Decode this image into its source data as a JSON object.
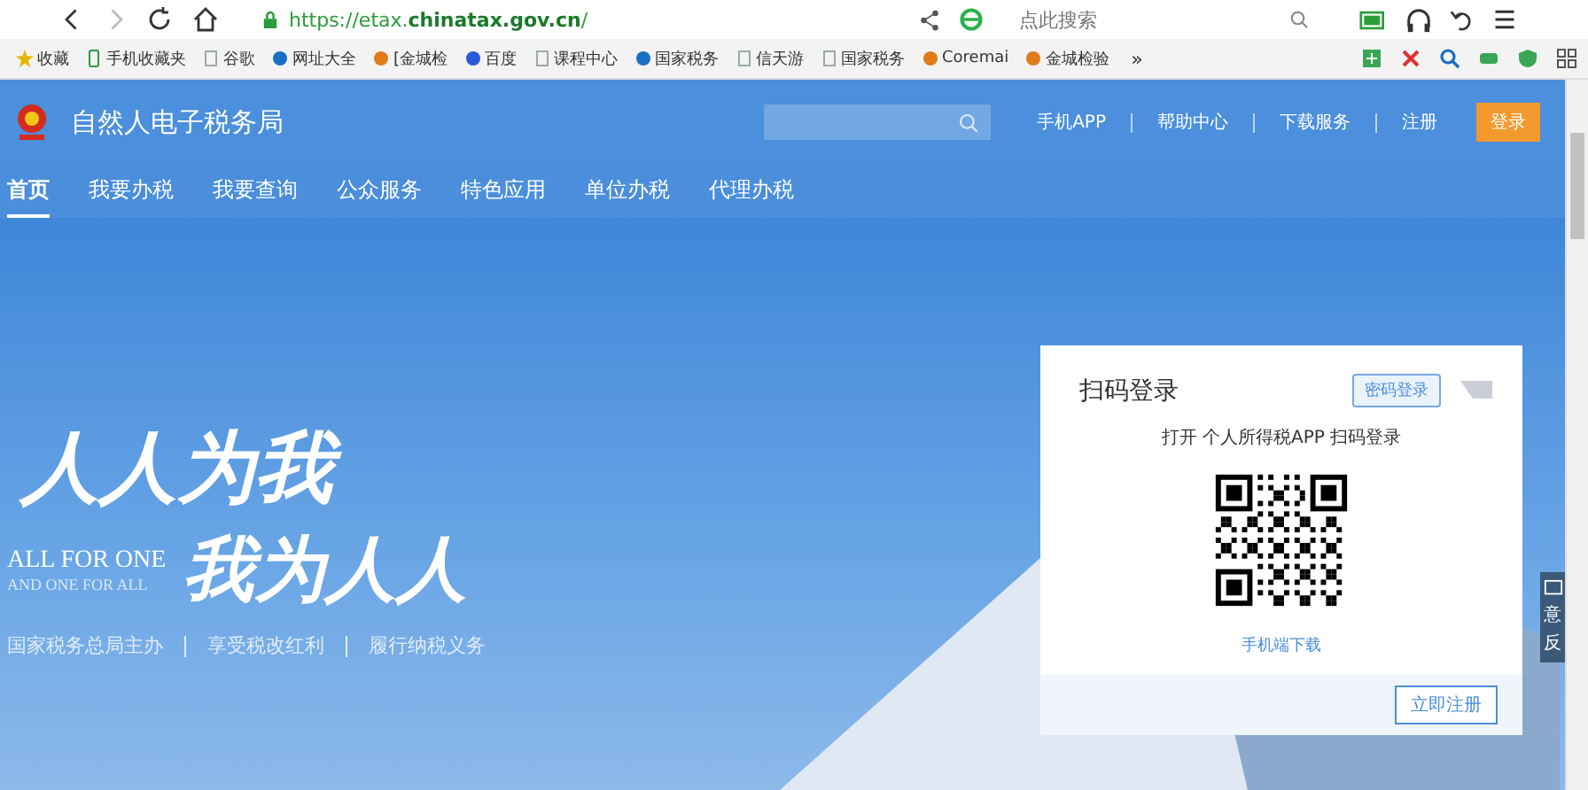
{
  "browser": {
    "url": "https://etax.**chinatax.gov.cn**/",
    "search": {
      "placeholder": "点此搜索"
    },
    "bookmarks": [
      {
        "label": "收藏",
        "kind": "star"
      },
      {
        "label": "手机收藏夹",
        "kind": "phone"
      },
      {
        "label": "谷歌",
        "kind": "page"
      },
      {
        "label": "网址大全",
        "kind": "globe"
      },
      {
        "label": "[金城检",
        "kind": "logo"
      },
      {
        "label": "百度",
        "kind": "paw"
      },
      {
        "label": "课程中心",
        "kind": "page"
      },
      {
        "label": "国家税务",
        "kind": "globe"
      },
      {
        "label": "信天游",
        "kind": "page"
      },
      {
        "label": "国家税务",
        "kind": "page"
      },
      {
        "label": "Coremai",
        "kind": "logo"
      },
      {
        "label": "金城检验",
        "kind": "logo"
      }
    ],
    "more": "»"
  },
  "site": {
    "title": "自然人电子税务局",
    "links": [
      "手机APP",
      "帮助中心",
      "下载服务",
      "注册"
    ],
    "login": "登录",
    "nav": [
      {
        "label": "首页",
        "selected": true
      },
      {
        "label": "我要办税",
        "selected": false
      },
      {
        "label": "我要查询",
        "selected": false
      },
      {
        "label": "公众服务",
        "selected": false
      },
      {
        "label": "特色应用",
        "selected": false
      },
      {
        "label": "单位办税",
        "selected": false
      },
      {
        "label": "代理办税",
        "selected": false
      }
    ]
  },
  "hero": {
    "slogan_1": "人人为我",
    "slogan_2": "我为人人",
    "english_1": "ALL FOR ONE",
    "english_2": "AND ONE FOR ALL",
    "taglines": [
      "国家税务总局主办",
      "享受税改红利",
      "履行纳税义务"
    ]
  },
  "login_card": {
    "title": "扫码登录",
    "password_login": "密码登录",
    "instruction": "打开 个人所得税APP 扫码登录",
    "download": "手机端下载",
    "register": "立即注册"
  },
  "feedback": {
    "chars": [
      "意",
      "反"
    ]
  }
}
